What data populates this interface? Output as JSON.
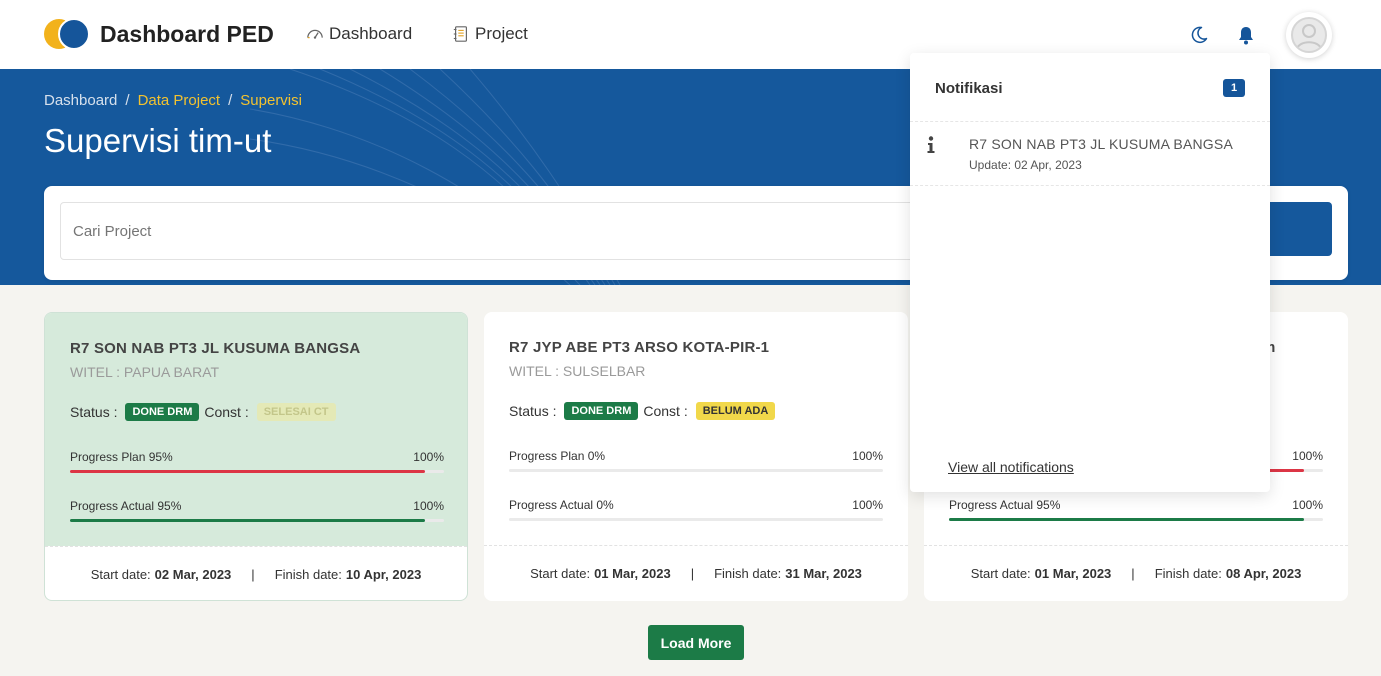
{
  "navbar": {
    "brand": "Dashboard PED",
    "nav_items": [
      {
        "label": "Dashboard",
        "icon": "gauge-icon"
      },
      {
        "label": "Project",
        "icon": "notebook-icon"
      }
    ],
    "icons": [
      "moon-icon",
      "bell-icon",
      "user-avatar-icon"
    ]
  },
  "hero": {
    "breadcrumb": [
      "Dashboard",
      "Data Project",
      "Supervisi"
    ],
    "separator": "/",
    "title": "Supervisi tim-ut"
  },
  "search": {
    "placeholder": "Cari Project"
  },
  "labels": {
    "status": "Status :",
    "const": "Const :",
    "start_date": "Start date:",
    "finish_date": "Finish date:",
    "max": "100%",
    "foot_sep": "|"
  },
  "cards": [
    {
      "title": "R7 SON NAB PT3 JL KUSUMA BANGSA",
      "witel": "WITEL : PAPUA BARAT",
      "status_badge": "DONE DRM",
      "const_badge": "SELESAI CT",
      "plan_label": "Progress Plan 95%",
      "plan_value": 95,
      "actual_label": "Progress Actual 95%",
      "actual_value": 95,
      "start": "02 Mar, 2023",
      "finish": "10 Apr, 2023"
    },
    {
      "title": "R7 JYP ABE PT3 ARSO KOTA-PIR-1",
      "witel": "WITEL : SULSELBAR",
      "status_badge": "DONE DRM",
      "const_badge": "BELUM ADA",
      "plan_label": "Progress Plan 0%",
      "plan_value": 0,
      "actual_label": "Progress Actual 0%",
      "actual_value": 0,
      "start": "01 Mar, 2023",
      "finish": "31 Mar, 2023"
    },
    {
      "title_tail": "m",
      "plan_value": 95,
      "actual_label": "Progress Actual 95%",
      "actual_value": 95,
      "start": "01 Mar, 2023",
      "finish": "08 Apr, 2023"
    }
  ],
  "load_more": "Load More",
  "notifications": {
    "title": "Notifikasi",
    "count": "1",
    "items": [
      {
        "title": "R7 SON NAB PT3 JL KUSUMA BANGSA",
        "date": "Update: 02 Apr, 2023",
        "icon": "info-icon"
      }
    ],
    "view_all": "View all notifications"
  },
  "colors": {
    "primary": "#15589c",
    "accent": "#f2c230",
    "success": "#1c7b47",
    "danger": "#dc3545",
    "warning": "#f1d84a"
  }
}
